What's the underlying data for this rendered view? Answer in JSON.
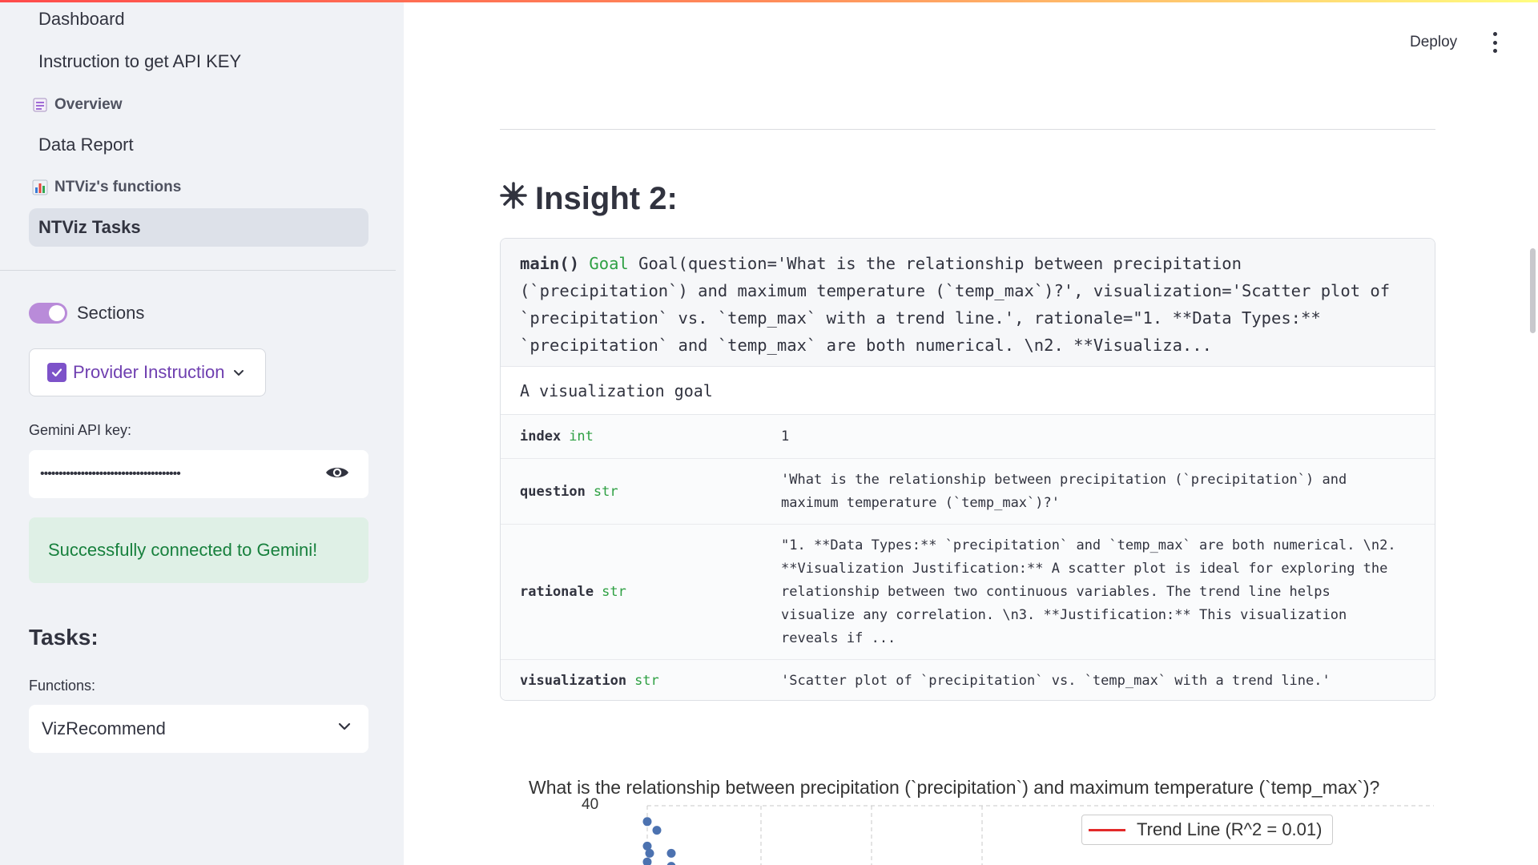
{
  "sidebar": {
    "nav_links": {
      "dashboard": "Dashboard",
      "api_instruction": "Instruction to get API KEY",
      "data_report": "Data Report",
      "ntviz_tasks": "NTViz Tasks"
    },
    "headers": {
      "overview": "Overview",
      "overview_icon": "notebook-icon",
      "functions": "NTViz's functions",
      "functions_icon": "bar-chart-icon"
    },
    "sections_toggle": {
      "label": "Sections",
      "on": true
    },
    "provider_button": {
      "label": "Provider Instruction",
      "icon": "checkbox-icon"
    },
    "api_key": {
      "label": "Gemini API key:",
      "masked_value": "••••••••••••••••••••••••••••••••••••••"
    },
    "success_message": "Successfully connected to Gemini!",
    "tasks_heading": "Tasks:",
    "functions_label": "Functions:",
    "functions_select": "VizRecommend"
  },
  "header": {
    "deploy_label": "Deploy"
  },
  "main": {
    "insight_title": "Insight 2:",
    "goal_card": {
      "header_prefix": "main()",
      "header_class": "Goal",
      "header_repr": "Goal(question='What is the relationship between precipitation (`precipitation`) and maximum temperature (`temp_max`)?', visualization='Scatter plot of `precipitation` vs. `temp_max` with a trend line.', rationale=\"1. **Data Types:** `precipitation` and `temp_max` are both numerical. \\n2. **Visualiza...",
      "docstring": "A visualization goal",
      "fields": [
        {
          "name": "index",
          "type": "int",
          "value": "1"
        },
        {
          "name": "question",
          "type": "str",
          "value": "'What is the relationship between precipitation (`precipitation`) and maximum temperature (`temp_max`)?'"
        },
        {
          "name": "rationale",
          "type": "str",
          "value": "\"1. **Data Types:** `precipitation` and `temp_max` are both numerical. \\n2. **Visualization Justification:** A scatter plot is ideal for exploring the relationship between two continuous variables. The trend line helps visualize any correlation. \\n3. **Justification:** This visualization reveals if ..."
        },
        {
          "name": "visualization",
          "type": "str",
          "value": "'Scatter plot of `precipitation` vs. `temp_max` with a trend line.'"
        }
      ]
    }
  },
  "chart_data": {
    "type": "scatter",
    "title": "What is the relationship between precipitation (`precipitation`) and maximum temperature (`temp_max`)?",
    "y_ticks": [
      "40"
    ],
    "legend": [
      "Trend Line (R^2 = 0.01)"
    ],
    "legend_position": "top-right",
    "grid": true,
    "point_color": "#4c72b0",
    "trend_line_color": "#e32929",
    "points": [
      {
        "x": 0.0,
        "y": 38.9
      },
      {
        "x": 0.4,
        "y": 38.3
      },
      {
        "x": 0.0,
        "y": 37.2
      },
      {
        "x": 0.1,
        "y": 36.7
      },
      {
        "x": 0.0,
        "y": 36.1
      },
      {
        "x": 1.0,
        "y": 36.7
      },
      {
        "x": 1.0,
        "y": 35.8
      }
    ]
  },
  "colors": {
    "accent": "#7d52c9",
    "success_text": "#17803d",
    "type_green": "#2ea043"
  }
}
